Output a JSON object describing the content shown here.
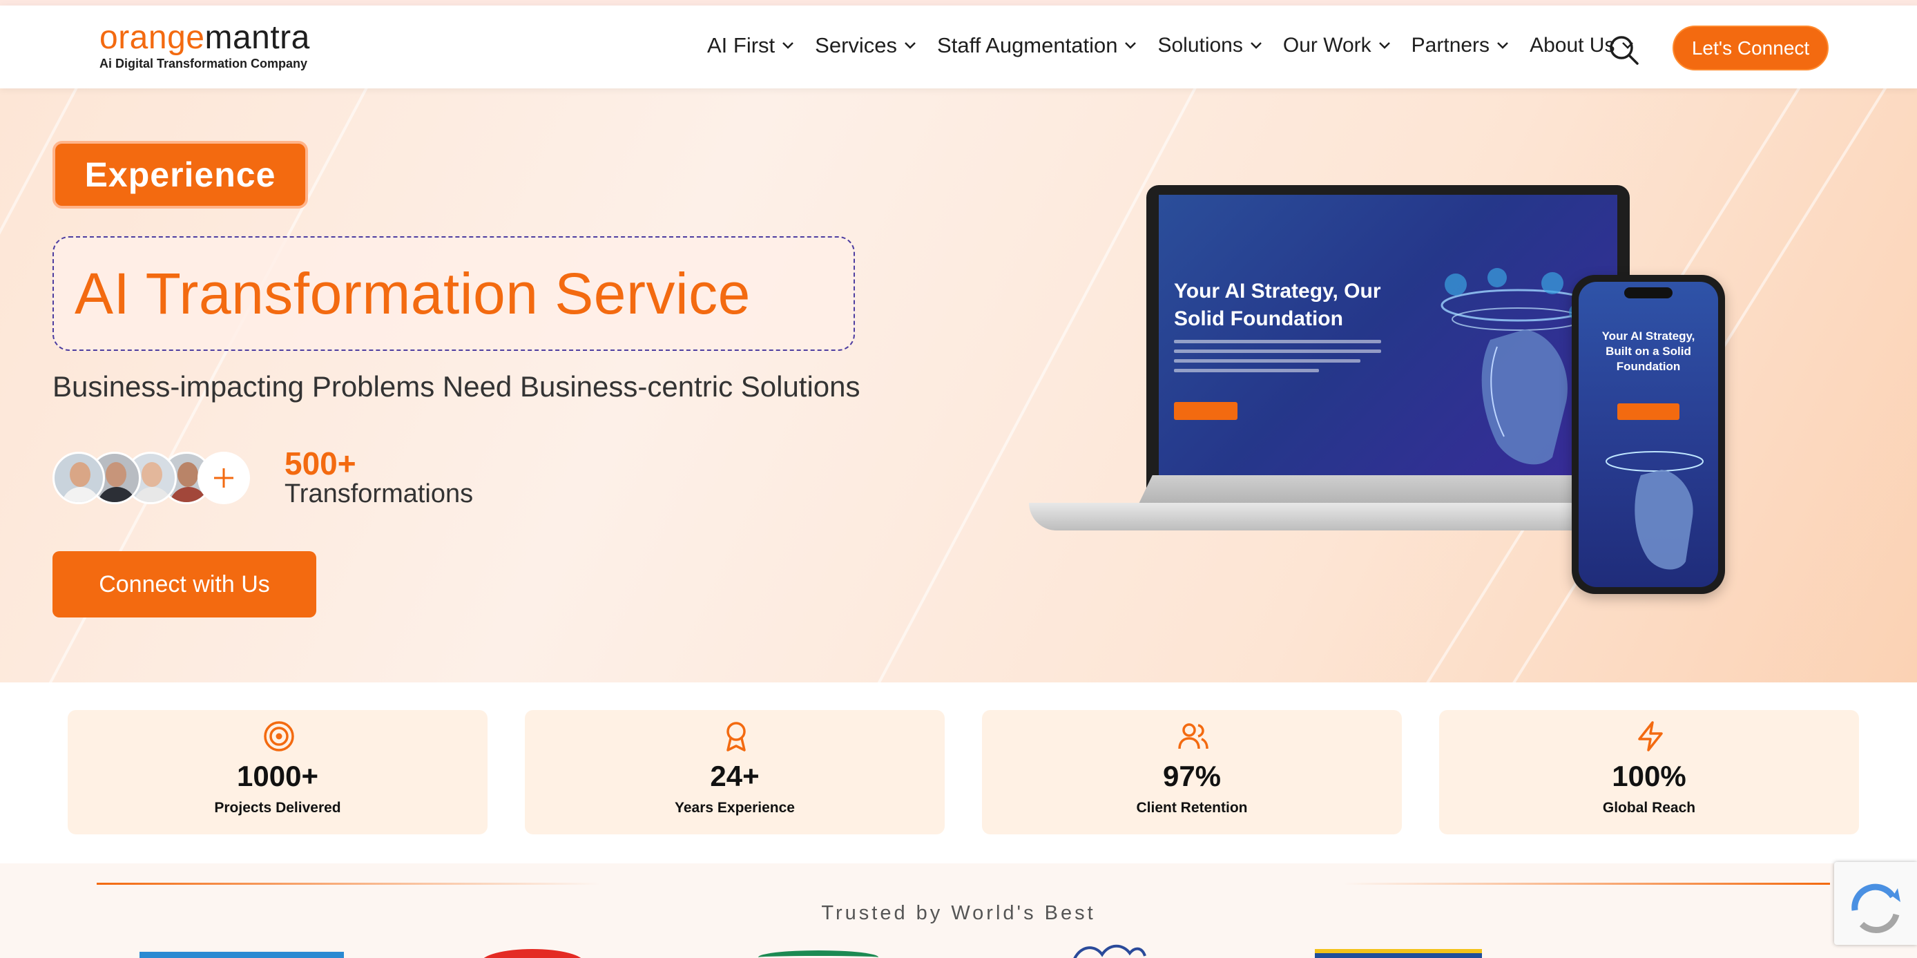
{
  "header": {
    "logo_part1": "orange",
    "logo_part2": "mantra",
    "logo_tagline": "Ai Digital Transformation Company",
    "nav": [
      {
        "label": "AI First"
      },
      {
        "label": "Services"
      },
      {
        "label": "Staff Augmentation"
      },
      {
        "label": "Solutions"
      },
      {
        "label": "Our Work"
      },
      {
        "label": "Partners"
      },
      {
        "label": "About Us"
      }
    ],
    "search_icon": "search-icon",
    "cta_label": "Let's Connect"
  },
  "hero": {
    "badge": "Experience",
    "title": "AI Transformation Service",
    "subtitle": "Business-impacting Problems Need Business-centric Solutions",
    "stat_value": "500+",
    "stat_label": "Transformations",
    "cta_label": "Connect with Us",
    "mockup": {
      "laptop_headline": "Your AI Strategy, Our Solid Foundation",
      "phone_headline": "Your AI Strategy, Built on a Solid Foundation"
    }
  },
  "stats": [
    {
      "icon": "target-icon",
      "value": "1000+",
      "label": "Projects Delivered"
    },
    {
      "icon": "award-icon",
      "value": "24+",
      "label": "Years Experience"
    },
    {
      "icon": "users-icon",
      "value": "97%",
      "label": "Client Retention"
    },
    {
      "icon": "lightning-icon",
      "value": "100%",
      "label": "Global Reach"
    }
  ],
  "trusted": {
    "heading": "Trusted by World's Best"
  },
  "colors": {
    "brand_orange": "#f36a10",
    "card_bg": "#fff1e4"
  }
}
